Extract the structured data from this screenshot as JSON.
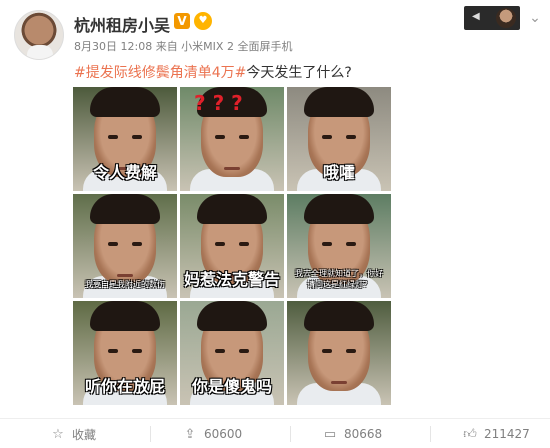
{
  "header": {
    "user_name": "杭州租房小吴",
    "verified_badge": "V",
    "vip_icon": "heart-icon",
    "meta": "8月30日 12:08 来自 小米MIX 2 全面屏手机",
    "gallery_icon": "chevron-left-icon",
    "expand_icon": "chevron-down-icon"
  },
  "post": {
    "topic": "#提发际线修鬓角清单4万#",
    "text": "今天发生了什么?"
  },
  "images": [
    {
      "caption": "令人费解",
      "style": "big",
      "bg": "#4d5a3c"
    },
    {
      "caption": "",
      "style": "big",
      "bg": "#6f8a69",
      "marks": "? ? ?"
    },
    {
      "caption": "哦嚯",
      "style": "big",
      "bg": "#8d8a80"
    },
    {
      "caption": "我要自是我附近的数伤",
      "style": "small",
      "bg": "#5f6e4a"
    },
    {
      "caption": "妈惹法克警告",
      "style": "big",
      "bg": "#7a8c6a"
    },
    {
      "caption": "我去全理就知道了，你好\n请问这是红绿灯？",
      "style": "small",
      "bg": "#5d7d63"
    },
    {
      "caption": "听你在放屁",
      "style": "big",
      "bg": "#5e6a44"
    },
    {
      "caption": "你是傻鬼吗",
      "style": "big",
      "bg": "#9aa893"
    },
    {
      "caption": "",
      "style": "big",
      "bg": "#4f5d3f"
    }
  ],
  "actions": {
    "favorite": {
      "label": "收藏",
      "icon": "star-icon"
    },
    "share": {
      "count": "60600",
      "icon": "share-icon"
    },
    "comment": {
      "count": "80668",
      "icon": "comment-icon"
    },
    "like": {
      "count": "211427",
      "icon": "thumbs-up-icon"
    }
  },
  "colors": {
    "topic": "#eb7350",
    "name": "#333333",
    "meta": "#808080"
  }
}
